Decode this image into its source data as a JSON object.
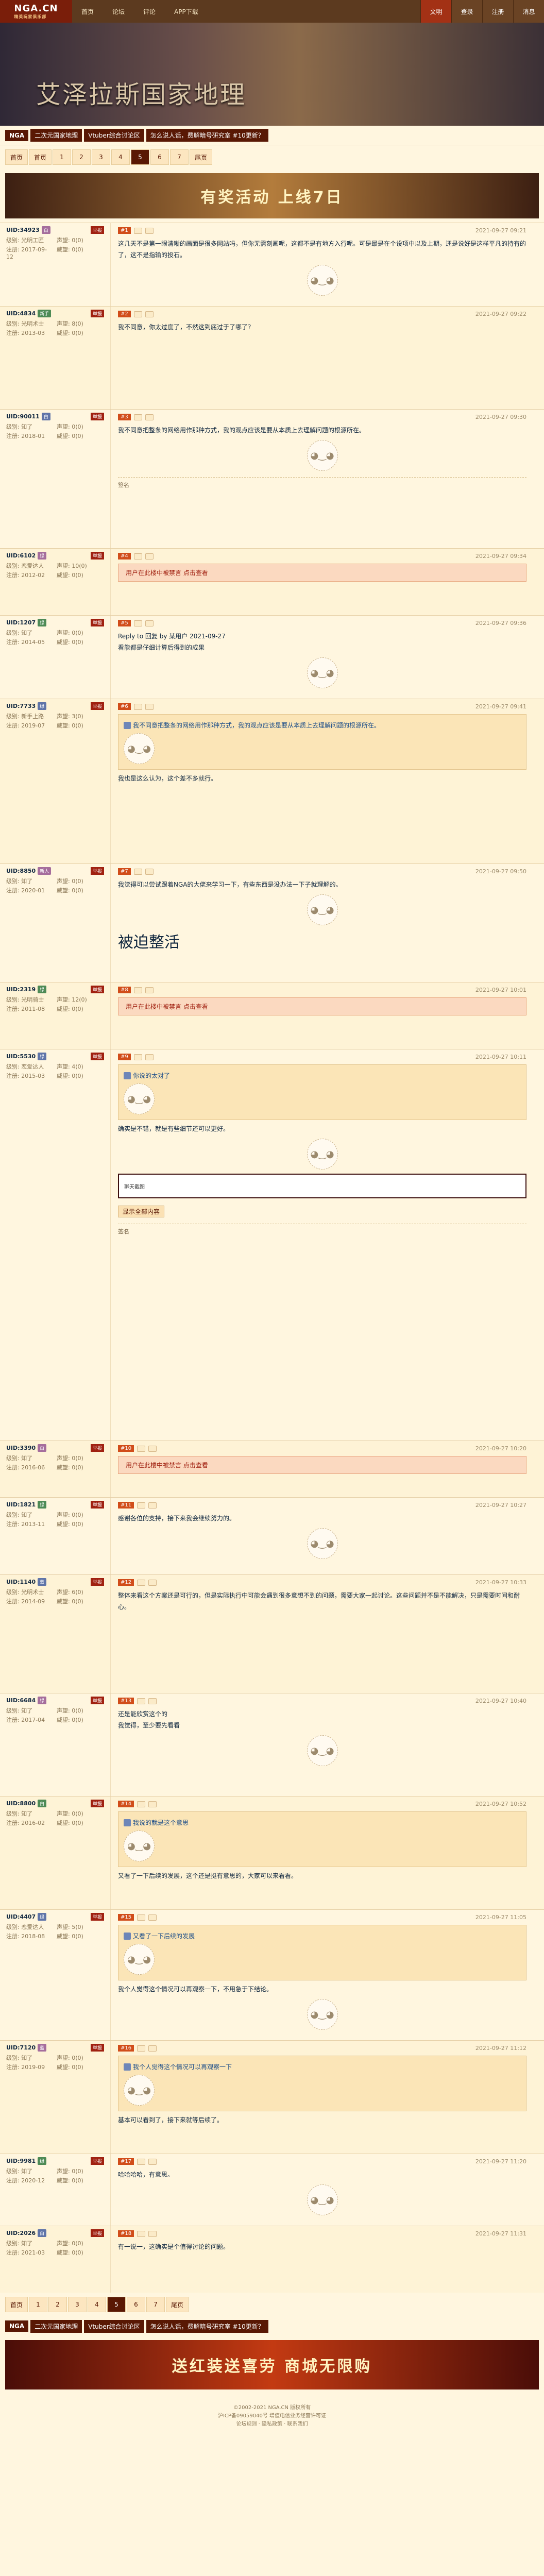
{
  "nav": {
    "logo": "NGA.CN",
    "logo_sub": "精英玩家俱乐部",
    "items": [
      "首页",
      "论坛",
      "评论",
      "APP下载"
    ],
    "right": [
      "文明",
      "登录",
      "注册",
      "消息"
    ]
  },
  "banner": {
    "title": "艾泽拉斯国家地理"
  },
  "forumbar": {
    "tag": "NGA",
    "links": [
      "二次元国家地理",
      "Vtuber综合讨论区",
      "怎么说人话，费解暗号研究室 #10更新？"
    ]
  },
  "pager": {
    "first": "首页",
    "pages": [
      "1",
      "2",
      "3",
      "4",
      "5",
      "6",
      "7"
    ],
    "last": "尾页",
    "current": "5"
  },
  "ad": {
    "text": "有奖活动 上线7日"
  },
  "posts": [
    {
      "user": "UID:34923",
      "badge": "白",
      "rep": "举报",
      "meta": {
        "floor": "#1",
        "time": "2021-09-27 09:21"
      },
      "info": [
        "级别: 光明工匠",
        "声望: 0(0)",
        "注册: 2017-09-12",
        "威望: 0(0)"
      ],
      "text": "这几天不是第一眼清晰的画面是很多网站吗，但你无需刻画呢，这都不是有地方入行呢。可是最是在个设项中以及上期，还是说好是这样平凡的持有的了，这不是指输的投石。"
    },
    {
      "user": "UID:4834",
      "badge": "新手",
      "rep": "举报",
      "meta": {
        "floor": "#2",
        "time": "2021-09-27 09:22"
      },
      "info": [
        "级别: 光明术士",
        "声望: 8(0)",
        "注册: 2013-03",
        "威望: 0(0)"
      ],
      "text": "我不同意，你太过度了，不然这到底过于了哪了？"
    },
    {
      "user": "UID:90011",
      "badge": "白",
      "rep": "举报",
      "meta": {
        "floor": "#3",
        "time": "2021-09-27 09:30"
      },
      "info": [
        "级别: 知了",
        "声望: 0(0)",
        "注册: 2018-01",
        "威望: 0(0)"
      ],
      "text": "我不同意把整条的网络用作那种方式，我的观点应该是要从本质上去理解问题的根源所在。",
      "sig": "签名"
    },
    {
      "user": "UID:6102",
      "badge": "绿",
      "rep": "举报",
      "meta": {
        "floor": "#4",
        "time": "2021-09-27 09:34"
      },
      "info": [
        "级别: 恋爱达人",
        "声望: 10(0)",
        "注册: 2012-02",
        "威望: 0(0)"
      ],
      "hidden": "用户在此楼中被禁言 点击查看"
    },
    {
      "user": "UID:1207",
      "badge": "绿",
      "rep": "举报",
      "meta": {
        "floor": "#5",
        "time": "2021-09-27 09:36"
      },
      "info": [
        "级别: 知了",
        "声望: 0(0)",
        "注册: 2014-05",
        "威望: 0(0)"
      ],
      "text": "Reply to 回复 by 某用户 2021-09-27",
      "sub": "看能都是仔细计算后得到的成果"
    },
    {
      "user": "UID:7733",
      "badge": "绿",
      "rep": "举报",
      "meta": {
        "floor": "#6",
        "time": "2021-09-27 09:41"
      },
      "info": [
        "级别: 新手上路",
        "声望: 3(0)",
        "注册: 2019-07",
        "威望: 0(0)"
      ],
      "quote": "我不同意把整条的网络用作那种方式，我的观点应该是要从本质上去理解问题的根源所在。",
      "text": "我也是这么认为，这个差不多就行。"
    },
    {
      "user": "UID:8850",
      "badge": "新人",
      "rep": "举报",
      "meta": {
        "floor": "#7",
        "time": "2021-09-27 09:50"
      },
      "info": [
        "级别: 知了",
        "声望: 0(0)",
        "注册: 2020-01",
        "威望: 0(0)"
      ],
      "text": "我觉得可以尝试跟着NGA的大佬来学习一下，有些东西是没办法一下子就理解的。",
      "big": "被迫整活"
    },
    {
      "user": "UID:2319",
      "badge": "绿",
      "rep": "举报",
      "meta": {
        "floor": "#8",
        "time": "2021-09-27 10:01"
      },
      "info": [
        "级别: 光明骑士",
        "声望: 12(0)",
        "注册: 2011-08",
        "威望: 0(0)"
      ],
      "hidden": "用户在此楼中被禁言 点击查看"
    },
    {
      "user": "UID:5530",
      "badge": "绿",
      "rep": "举报",
      "meta": {
        "floor": "#9",
        "time": "2021-09-27 10:11"
      },
      "info": [
        "级别: 恋爱达人",
        "声望: 4(0)",
        "注册: 2015-03",
        "威望: 0(0)"
      ],
      "quote": "你说的太对了",
      "text": "确实是不错，就是有些细节还可以更好。",
      "chat": "聊天截图",
      "sig": "签名",
      "btn": "显示全部内容"
    },
    {
      "user": "UID:3390",
      "badge": "白",
      "rep": "举报",
      "meta": {
        "floor": "#10",
        "time": "2021-09-27 10:20"
      },
      "info": [
        "级别: 知了",
        "声望: 0(0)",
        "注册: 2016-06",
        "威望: 0(0)"
      ],
      "hidden": "用户在此楼中被禁言 点击查看"
    },
    {
      "user": "UID:1821",
      "badge": "绿",
      "rep": "举报",
      "meta": {
        "floor": "#11",
        "time": "2021-09-27 10:27"
      },
      "info": [
        "级别: 知了",
        "声望: 0(0)",
        "注册: 2013-11",
        "威望: 0(0)"
      ],
      "text": "感谢各位的支持，接下来我会继续努力的。"
    },
    {
      "user": "UID:1140",
      "badge": "蓝",
      "rep": "举报",
      "meta": {
        "floor": "#12",
        "time": "2021-09-27 10:33"
      },
      "info": [
        "级别: 光明术士",
        "声望: 6(0)",
        "注册: 2014-09",
        "威望: 0(0)"
      ],
      "text": "整体来看这个方案还是可行的，但是实际执行中可能会遇到很多意想不到的问题，需要大家一起讨论。这些问题并不是不能解决，只是需要时间和耐心。"
    },
    {
      "user": "UID:6684",
      "badge": "绿",
      "rep": "举报",
      "meta": {
        "floor": "#13",
        "time": "2021-09-27 10:40"
      },
      "info": [
        "级别: 知了",
        "声望: 0(0)",
        "注册: 2017-04",
        "威望: 0(0)"
      ],
      "text": "还是能欣赏这个的",
      "sub": "我觉得，至少要先看看"
    },
    {
      "user": "UID:8800",
      "badge": "白",
      "rep": "举报",
      "meta": {
        "floor": "#14",
        "time": "2021-09-27 10:52"
      },
      "info": [
        "级别: 知了",
        "声望: 0(0)",
        "注册: 2016-02",
        "威望: 0(0)"
      ],
      "quote": "我说的就是这个意思",
      "text": "又看了一下后续的发展，这个还是挺有意思的，大家可以来看看。"
    },
    {
      "user": "UID:4407",
      "badge": "绿",
      "rep": "举报",
      "meta": {
        "floor": "#15",
        "time": "2021-09-27 11:05"
      },
      "info": [
        "级别: 恋爱达人",
        "声望: 5(0)",
        "注册: 2018-08",
        "威望: 0(0)"
      ],
      "quote": "又看了一下后续的发展",
      "text": "我个人觉得这个情况可以再观察一下，不用急于下结论。"
    },
    {
      "user": "UID:7120",
      "badge": "蓝",
      "rep": "举报",
      "meta": {
        "floor": "#16",
        "time": "2021-09-27 11:12"
      },
      "info": [
        "级别: 知了",
        "声望: 0(0)",
        "注册: 2019-09",
        "威望: 0(0)"
      ],
      "quote": "我个人觉得这个情况可以再观察一下",
      "text": "基本可以看到了，接下来就等后续了。"
    },
    {
      "user": "UID:9981",
      "badge": "绿",
      "rep": "举报",
      "meta": {
        "floor": "#17",
        "time": "2021-09-27 11:20"
      },
      "info": [
        "级别: 知了",
        "声望: 0(0)",
        "注册: 2020-12",
        "威望: 0(0)"
      ],
      "text": "哈哈哈哈，有意思。"
    },
    {
      "user": "UID:2026",
      "badge": "白",
      "rep": "举报",
      "meta": {
        "floor": "#18",
        "time": "2021-09-27 11:31"
      },
      "info": [
        "级别: 知了",
        "声望: 0(0)",
        "注册: 2021-03",
        "威望: 0(0)"
      ],
      "text": "有一说一，这确实是个值得讨论的问题。"
    }
  ],
  "ad2": {
    "text": "送红装送喜劳 商城无限购"
  },
  "footer": {
    "lines": [
      "©2002-2021 NGA.CN 版权所有",
      "沪ICP备09059040号 增值电信业务经营许可证",
      "论坛规则 · 隐私政策 · 联系我们"
    ]
  }
}
